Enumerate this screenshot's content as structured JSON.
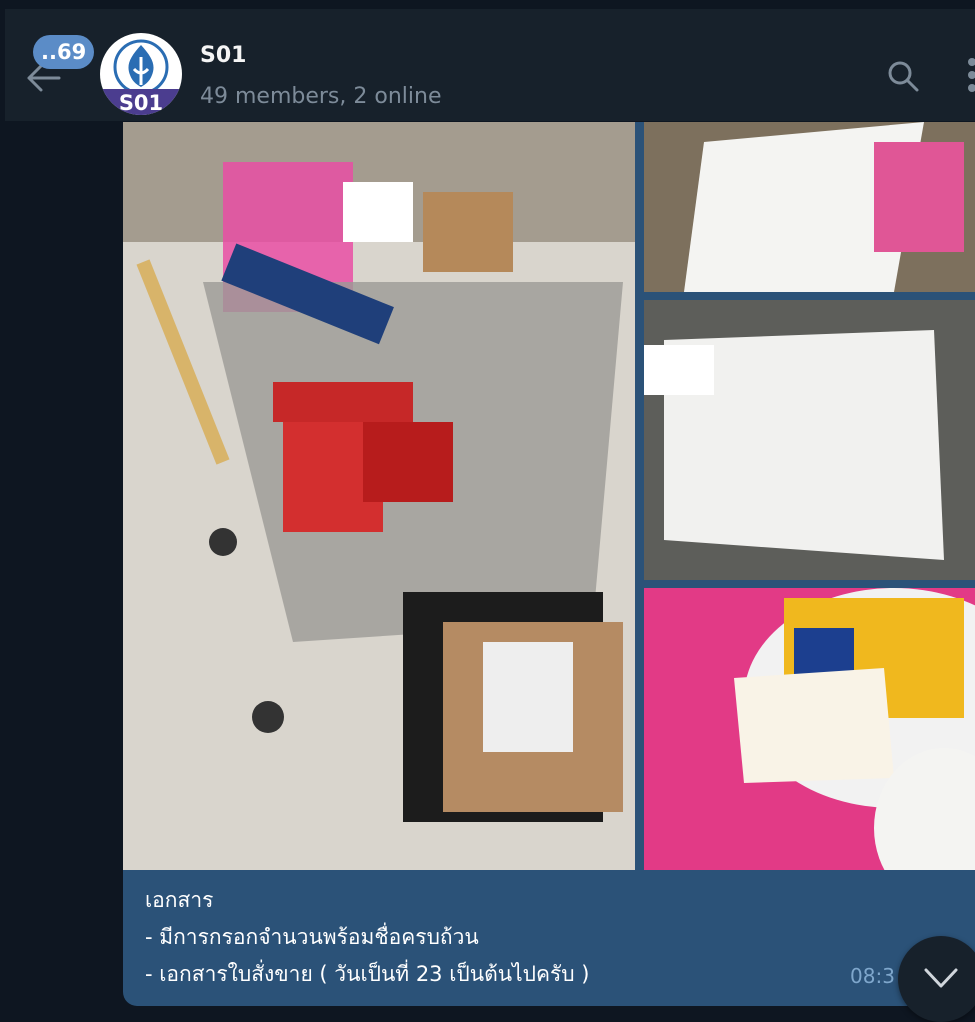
{
  "header": {
    "unread_count": "..69",
    "title": "S01",
    "subtitle": "49 members, 2 online",
    "avatar_text": "S01"
  },
  "message": {
    "caption_lines": [
      "เอกสาร",
      "- มีการกรอกจำนวนพร้อมชื่อครบถ้วน",
      "- เอกสารใบสั่งขาย ( วันเป็นที่ 23 เป็นต้นไปครับ )"
    ],
    "time": "08:3"
  },
  "colors": {
    "background": "#0e1621",
    "header": "#17212b",
    "bubble": "#2b5278",
    "badge": "#5b8cc7"
  },
  "icons": [
    "back-arrow-icon",
    "search-icon",
    "more-vert-icon",
    "chevron-down-icon"
  ]
}
